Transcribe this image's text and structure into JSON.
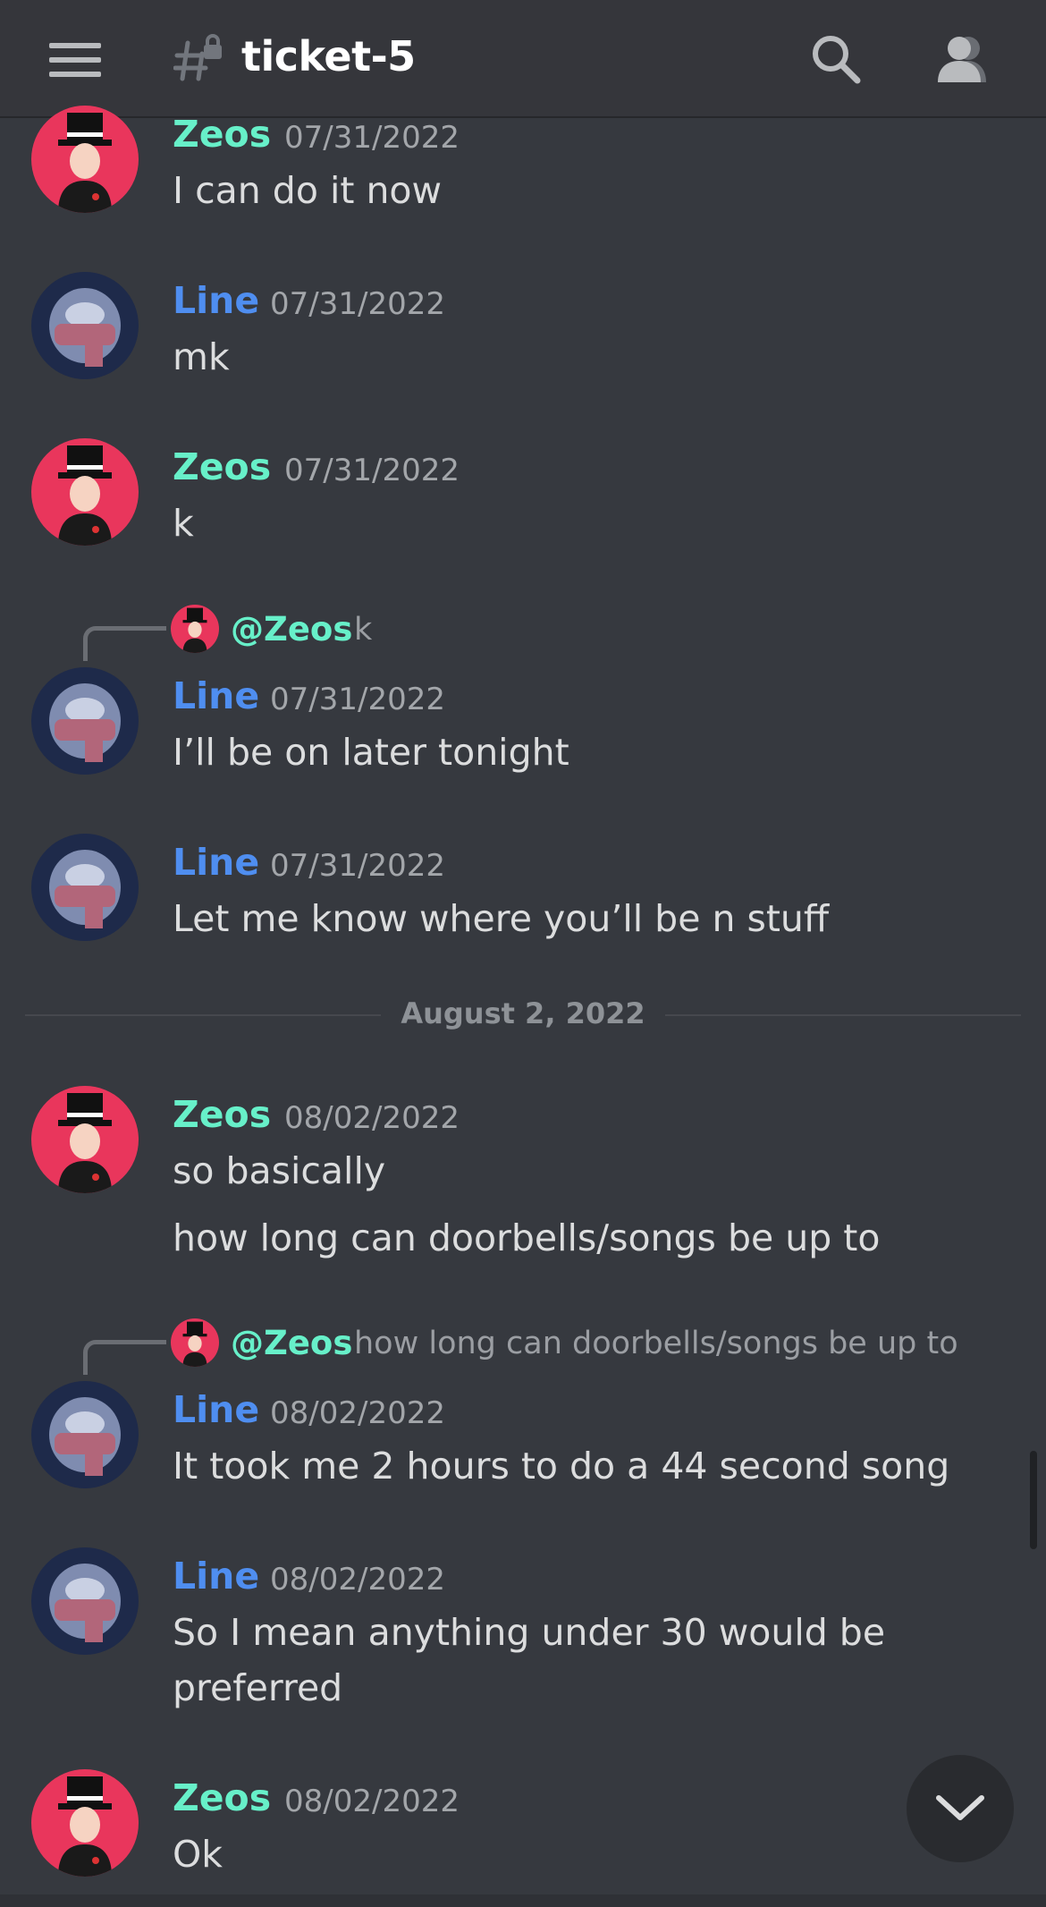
{
  "header": {
    "channel_name": "ticket-5",
    "menu_icon": "hamburger-menu-icon",
    "channel_icon": "locked-hashtag-icon",
    "search_icon": "search-icon",
    "members_icon": "members-icon"
  },
  "colors": {
    "background": "#36393f",
    "zeos_name": "#67f0c9",
    "line_name": "#4f8ef0",
    "zeos_avatar_bg": "#e9365c",
    "line_avatar_bg": "#1e2a4a"
  },
  "messages": [
    {
      "author": "Zeos",
      "timestamp": "07/31/2022",
      "lines": [
        "I can do it now"
      ]
    },
    {
      "author": "Line",
      "timestamp": "07/31/2022",
      "lines": [
        "mk"
      ]
    },
    {
      "author": "Zeos",
      "timestamp": "07/31/2022",
      "lines": [
        "k"
      ]
    },
    {
      "author": "Line",
      "timestamp": "07/31/2022",
      "reply_author": "@Zeos",
      "reply_text": "k",
      "lines": [
        "I’ll be on later tonight"
      ]
    },
    {
      "author": "Line",
      "timestamp": "07/31/2022",
      "lines": [
        "Let me know where you’ll be n stuff"
      ]
    },
    {
      "author": "Zeos",
      "timestamp": "08/02/2022",
      "lines": [
        "so basically",
        "how long can doorbells/songs be up to"
      ]
    },
    {
      "author": "Line",
      "timestamp": "08/02/2022",
      "reply_author": "@Zeos",
      "reply_text": "how long can doorbells/songs be up to",
      "lines": [
        "It took me 2 hours to do a 44 second song"
      ]
    },
    {
      "author": "Line",
      "timestamp": "08/02/2022",
      "lines": [
        "So I mean anything under 30 would be",
        "preferred"
      ]
    },
    {
      "author": "Zeos",
      "timestamp": "08/02/2022",
      "lines": [
        "Ok"
      ]
    }
  ],
  "date_divider": "August 2, 2022",
  "jump_button_icon": "chevron-down-icon"
}
